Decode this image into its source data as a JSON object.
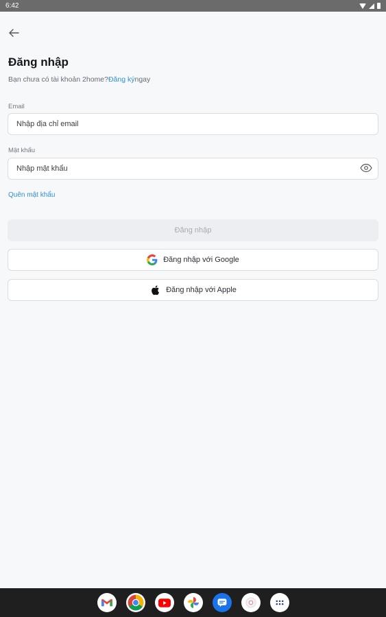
{
  "status_bar": {
    "time": "6:42"
  },
  "page": {
    "title": "Đăng nhập",
    "subtitle_prefix": "Bạn chưa có tài khoản 2home?",
    "signup_link": "Đăng ký",
    "subtitle_suffix": "ngay"
  },
  "email": {
    "label": "Email",
    "placeholder": "Nhập địa chỉ email"
  },
  "password": {
    "label": "Mật khẩu",
    "placeholder": "Nhập mật khẩu"
  },
  "forgot_password": "Quên mật khẩu",
  "buttons": {
    "login": "Đăng nhập",
    "google": "Đăng nhập với Google",
    "apple": "Đăng nhập với Apple"
  },
  "dock_apps": [
    "gmail-icon",
    "chrome-icon",
    "youtube-icon",
    "photos-icon",
    "messages-icon",
    "camera-icon",
    "app-drawer-icon"
  ]
}
